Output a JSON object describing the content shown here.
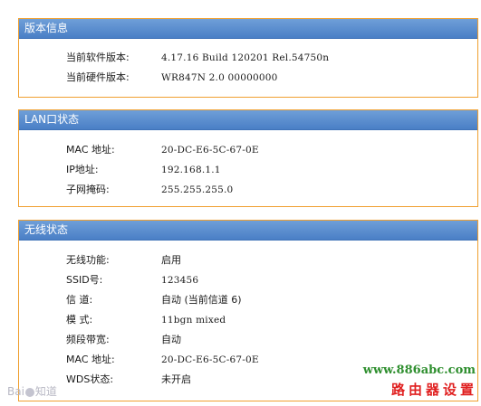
{
  "version_panel": {
    "title": "版本信息",
    "rows": [
      {
        "label": "当前软件版本:",
        "value": "4.17.16 Build 120201 Rel.54750n"
      },
      {
        "label": "当前硬件版本:",
        "value": "WR847N 2.0 00000000"
      }
    ]
  },
  "lan_panel": {
    "title": "LAN口状态",
    "rows": [
      {
        "label": "MAC 地址:",
        "value": "20-DC-E6-5C-67-0E"
      },
      {
        "label": "IP地址:",
        "value": "192.168.1.1"
      },
      {
        "label": "子网掩码:",
        "value": "255.255.255.0"
      }
    ]
  },
  "wireless_panel": {
    "title": "无线状态",
    "rows": [
      {
        "label": "无线功能:",
        "value": "启用"
      },
      {
        "label": "SSID号:",
        "value": "123456"
      },
      {
        "label": "信 道:",
        "value": "自动 (当前信道 6)"
      },
      {
        "label": "模 式:",
        "value": "11bgn mixed"
      },
      {
        "label": "频段带宽:",
        "value": "自动"
      },
      {
        "label": "MAC 地址:",
        "value": "20-DC-E6-5C-67-0E"
      },
      {
        "label": "WDS状态:",
        "value": "未开启"
      }
    ]
  },
  "watermark": {
    "baidu_prefix": "Bai",
    "baidu_suffix": "知道",
    "site_url": "www.886abc.com",
    "site_name": "路由器设置"
  }
}
